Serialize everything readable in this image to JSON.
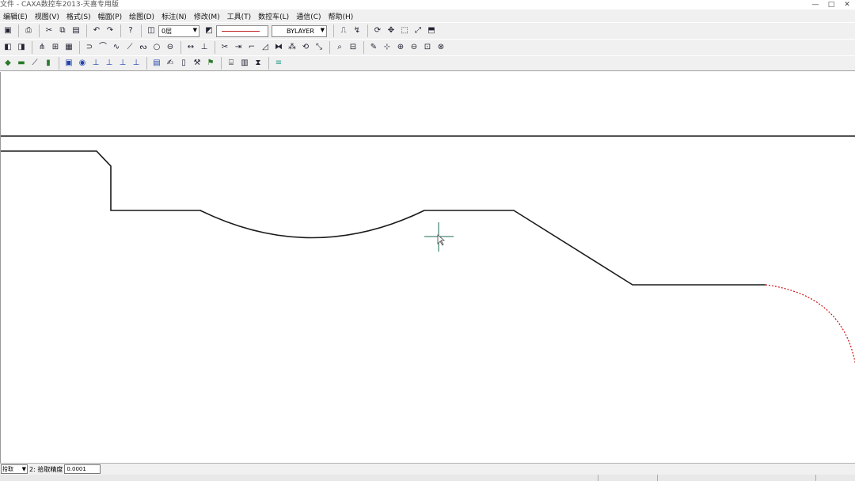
{
  "window": {
    "title": "文件 - CAXA数控车2013-天喜专用版",
    "controls": [
      "—",
      "□",
      "✕"
    ]
  },
  "menu": [
    "编辑(E)",
    "视图(V)",
    "格式(S)",
    "幅面(P)",
    "绘图(D)",
    "标注(N)",
    "修改(M)",
    "工具(T)",
    "数控车(L)",
    "通信(C)",
    "帮助(H)"
  ],
  "toolbar": {
    "layer_value": "0层",
    "linetype_value": "BYLAYER",
    "colors": {
      "linetype_swatch": "#c02020"
    }
  },
  "drawing": {
    "colors": {
      "profile": "#1a1a1a",
      "dotted_arc": "#d01010",
      "cursor": "#1a6a5a"
    }
  },
  "status": {
    "mode_value": "拾取",
    "precision_label": "2: 拾取精度",
    "precision_value": "0.0001"
  }
}
